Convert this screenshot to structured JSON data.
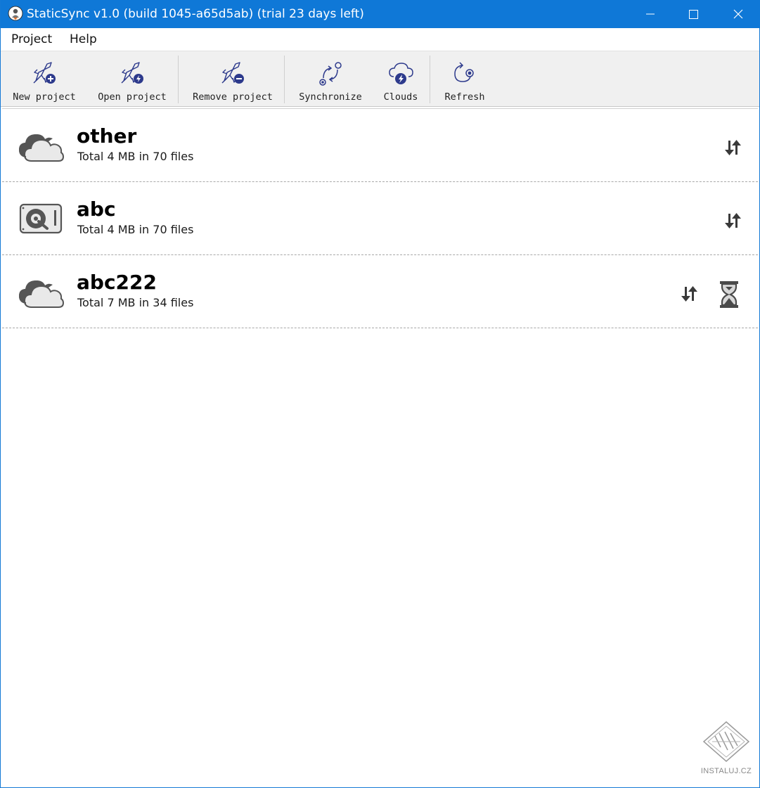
{
  "window": {
    "title": "StaticSync v1.0 (build 1045-a65d5ab) (trial 23 days left)",
    "accent_color": "#0f78d7"
  },
  "menu": {
    "items": [
      {
        "label": "Project"
      },
      {
        "label": "Help"
      }
    ]
  },
  "toolbar": {
    "buttons": [
      {
        "label": "New project",
        "icon": "rocket-plus-icon"
      },
      {
        "label": "Open project",
        "icon": "rocket-bolt-icon"
      },
      {
        "label": "Remove project",
        "icon": "rocket-minus-icon"
      },
      {
        "label": "Synchronize",
        "icon": "synchronize-icon"
      },
      {
        "label": "Clouds",
        "icon": "cloud-bolt-icon"
      },
      {
        "label": "Refresh",
        "icon": "refresh-icon"
      }
    ]
  },
  "projects": [
    {
      "name": "other",
      "stats": "Total 4 MB in 70 files",
      "icon": "cloud-icon",
      "busy": false
    },
    {
      "name": "abc",
      "stats": "Total 4 MB in 70 files",
      "icon": "hard-drive-icon",
      "busy": false
    },
    {
      "name": "abc222",
      "stats": "Total 7 MB in 34 files",
      "icon": "cloud-icon",
      "busy": true
    }
  ],
  "watermark": {
    "text": "INSTALUJ.CZ"
  }
}
